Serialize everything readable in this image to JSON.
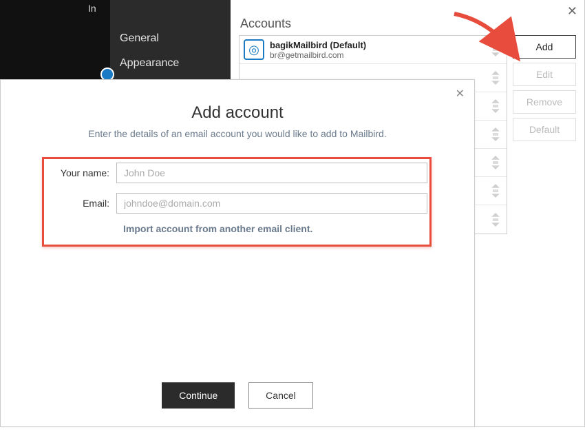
{
  "sidebar": {
    "items": [
      {
        "label": "General"
      },
      {
        "label": "Appearance"
      }
    ]
  },
  "header_fragment": "In",
  "accounts": {
    "title": "Accounts",
    "list": [
      {
        "name": "bagikMailbird (Default)",
        "email": "br@getmailbird.com"
      }
    ],
    "buttons": {
      "add": "Add",
      "edit": "Edit",
      "remove": "Remove",
      "default": "Default"
    }
  },
  "modal": {
    "title": "Add account",
    "subtitle": "Enter the details of an email account you would like to add to Mailbird.",
    "name_label": "Your name:",
    "name_placeholder": "John Doe",
    "email_label": "Email:",
    "email_placeholder": "johndoe@domain.com",
    "import_link": "Import account from another email client.",
    "continue": "Continue",
    "cancel": "Cancel"
  }
}
